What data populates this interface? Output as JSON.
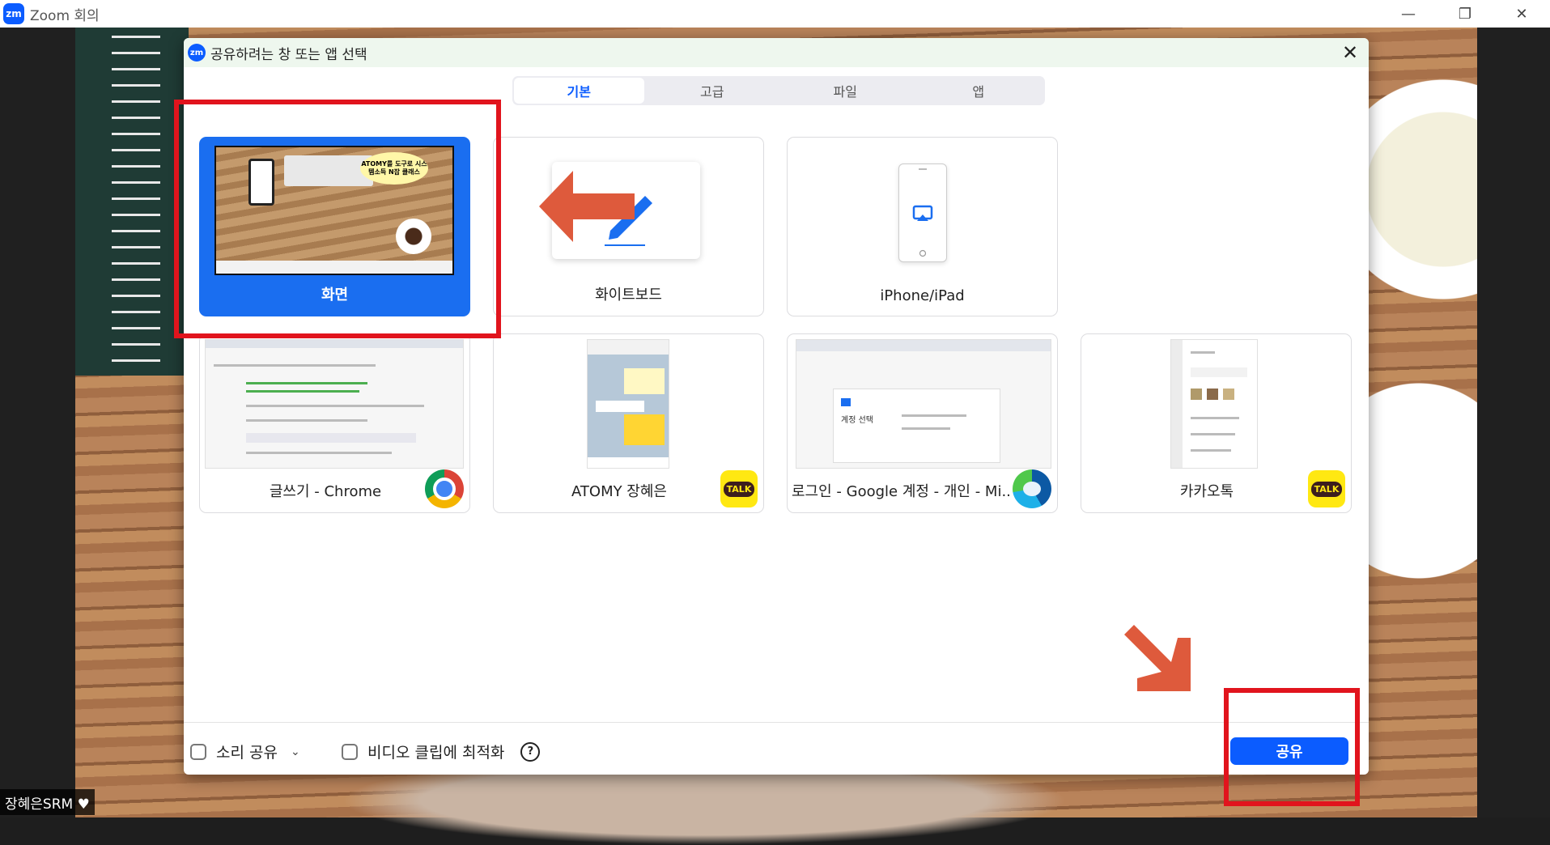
{
  "window": {
    "app_logo": "zm",
    "title": "Zoom 회의",
    "controls": [
      "minimize-icon",
      "restore-icon",
      "close-icon"
    ]
  },
  "dialog": {
    "logo": "zm",
    "title": "공유하려는 창 또는 앱 선택",
    "tabs": [
      {
        "label": "기본",
        "active": true
      },
      {
        "label": "고급",
        "active": false
      },
      {
        "label": "파일",
        "active": false
      },
      {
        "label": "앱",
        "active": false
      }
    ],
    "cards": [
      {
        "label": "화면",
        "selected": true,
        "thumb_badge": "ATOMY를 도구로 시스템소득 N잡 클래스"
      },
      {
        "label": "화이트보드",
        "selected": false
      },
      {
        "label": "iPhone/iPad",
        "selected": false
      },
      {
        "label": "글쓰기 - Chrome",
        "selected": false,
        "icon": "chrome-icon"
      },
      {
        "label": "ATOMY 장혜은",
        "selected": false,
        "icon": "kakaotalk-icon"
      },
      {
        "label": "로그인 - Google 계정 - 개인 - Mi...",
        "selected": false,
        "icon": "edge-icon"
      },
      {
        "label": "카카오톡",
        "selected": false,
        "icon": "kakaotalk-icon"
      }
    ],
    "kakao_badge_text": "TALK",
    "google_thumb_text": "계정 선택",
    "footer": {
      "share_sound": "소리 공유",
      "optimize_video": "비디오 클립에 최적화",
      "help_glyph": "?",
      "share_button": "공유"
    }
  },
  "speaker_label": "장혜은SRM ♥",
  "colors": {
    "accent": "#0b5cff",
    "selected_card": "#1a6ef0",
    "annotation_red": "#e1141d",
    "annotation_arrow": "#de5a3c"
  }
}
